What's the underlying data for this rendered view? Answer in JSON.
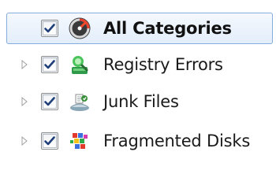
{
  "tree": {
    "items": [
      {
        "label": "All Categories",
        "checked": true,
        "selected": true,
        "has_expander": false,
        "icon": "speedometer-icon"
      },
      {
        "label": "Registry Errors",
        "checked": true,
        "selected": false,
        "has_expander": true,
        "icon": "registry-icon"
      },
      {
        "label": "Junk Files",
        "checked": true,
        "selected": false,
        "has_expander": true,
        "icon": "junk-files-icon"
      },
      {
        "label": "Fragmented Disks",
        "checked": true,
        "selected": false,
        "has_expander": true,
        "icon": "fragmented-disk-icon"
      }
    ]
  },
  "colors": {
    "selection_border": "#84acdd",
    "selection_fill": "#e3edfa",
    "checkmark": "#1f3f7a",
    "expander": "#a0a0a0"
  }
}
